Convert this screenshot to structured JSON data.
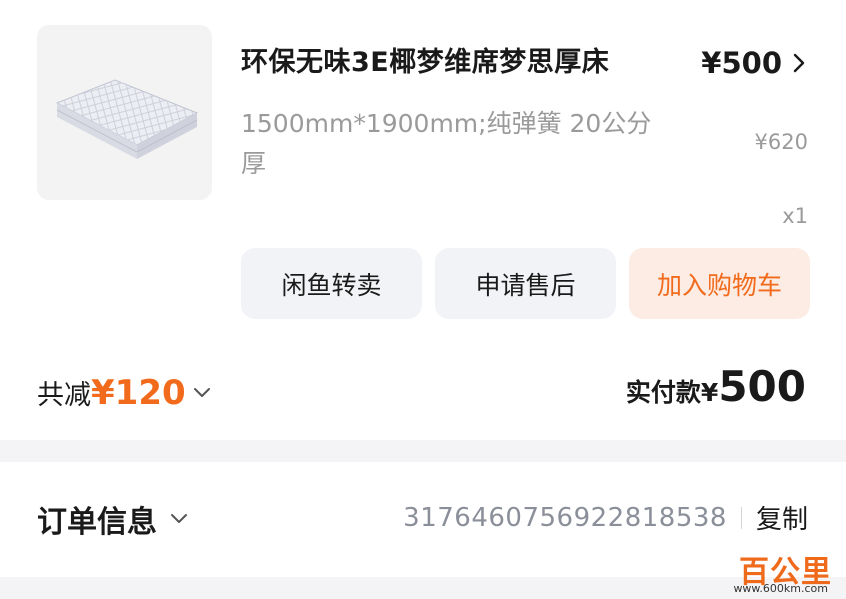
{
  "product": {
    "image_icon": "mattress-image",
    "title": "环保无味3E椰梦维席梦思厚床",
    "spec": "1500mm*1900mm;纯弹簧 20公分厚",
    "price": "¥500",
    "original_price": "¥620",
    "quantity": "x1"
  },
  "actions": {
    "resell_label": "闲鱼转卖",
    "aftersale_label": "申请售后",
    "add_cart_label": "加入购物车"
  },
  "summary": {
    "reduce_label": "共减",
    "reduce_amount": "¥120",
    "paid_label": "实付款¥",
    "paid_amount": "500"
  },
  "order": {
    "title": "订单信息",
    "order_number": "3176460756922818538",
    "copy_label": "复制"
  },
  "watermark": {
    "text": "百公里",
    "url": "www.600km.com"
  },
  "colors": {
    "accent": "#f26b1d",
    "accent_bg": "#fcece3",
    "button_bg": "#f2f3f6",
    "muted_text": "#9a9a9a",
    "band": "#f4f4f6"
  }
}
